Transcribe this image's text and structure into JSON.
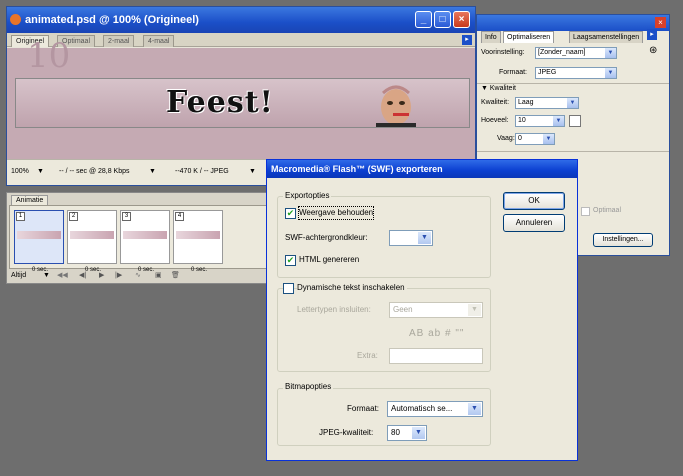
{
  "document_window": {
    "title": "animated.psd @ 100% (Origineel)",
    "tabs": [
      "Origineel",
      "Optimaal",
      "2-maal",
      "4-maal"
    ],
    "banner_text": "Feest!",
    "status": {
      "zoom": "100%",
      "speed": "-- / -- sec @ 28,8 Kbps",
      "size": "--470 K / -- JPEG"
    },
    "window_buttons": {
      "minimize": "_",
      "maximize": "□",
      "close": "×"
    }
  },
  "animation_panel": {
    "tab_label": "Animatie",
    "frames": [
      {
        "number": "1",
        "delay": "0 sec."
      },
      {
        "number": "2",
        "delay": "0 sec."
      },
      {
        "number": "3",
        "delay": "0 sec."
      },
      {
        "number": "4",
        "delay": "0 sec."
      }
    ],
    "loop_option": "Altijd"
  },
  "optimize_panel": {
    "tabs": [
      "Info",
      "Optimaliseren",
      "Laagsamenstellingen"
    ],
    "preset_label": "Voorinstelling:",
    "preset_value": "[Zonder_naam]",
    "format_label": "Formaat:",
    "format_value": "JPEG",
    "quality_section": "Kwaliteit",
    "quality_label": "Kwaliteit:",
    "quality_value": "Laag",
    "amount_label": "Hoeveel:",
    "amount_value": "10",
    "blur_label": "Vaag:",
    "blur_value": "0",
    "optimal_label": "Optimaal",
    "settings_button": "Instellingen..."
  },
  "dialog": {
    "title": "Macromedia® Flash™ (SWF) exporteren",
    "export_group": "Exportopties",
    "keep_appearance": "Weergave behouden",
    "swf_bg_label": "SWF-achtergrondkleur:",
    "html_generate": "HTML genereren",
    "dynamic_text": "Dynamische tekst inschakelen",
    "embed_fonts_label": "Lettertypen insluiten:",
    "embed_fonts_value": "Geen",
    "glyph_samples": "AB ab # \"\"",
    "extra_label": "Extra:",
    "bitmap_group": "Bitmapopties",
    "format_label": "Formaat:",
    "format_value": "Automatisch se...",
    "jpeg_quality_label": "JPEG-kwaliteit:",
    "jpeg_quality_value": "80",
    "ok": "OK",
    "cancel": "Annuleren",
    "checked": {
      "keep_appearance": true,
      "html_generate": true,
      "dynamic_text": false
    }
  },
  "colors": {
    "xp_title": "#1b4fc8",
    "workspace": "#6e6e6e",
    "banner_pink": "#c5aab3"
  }
}
